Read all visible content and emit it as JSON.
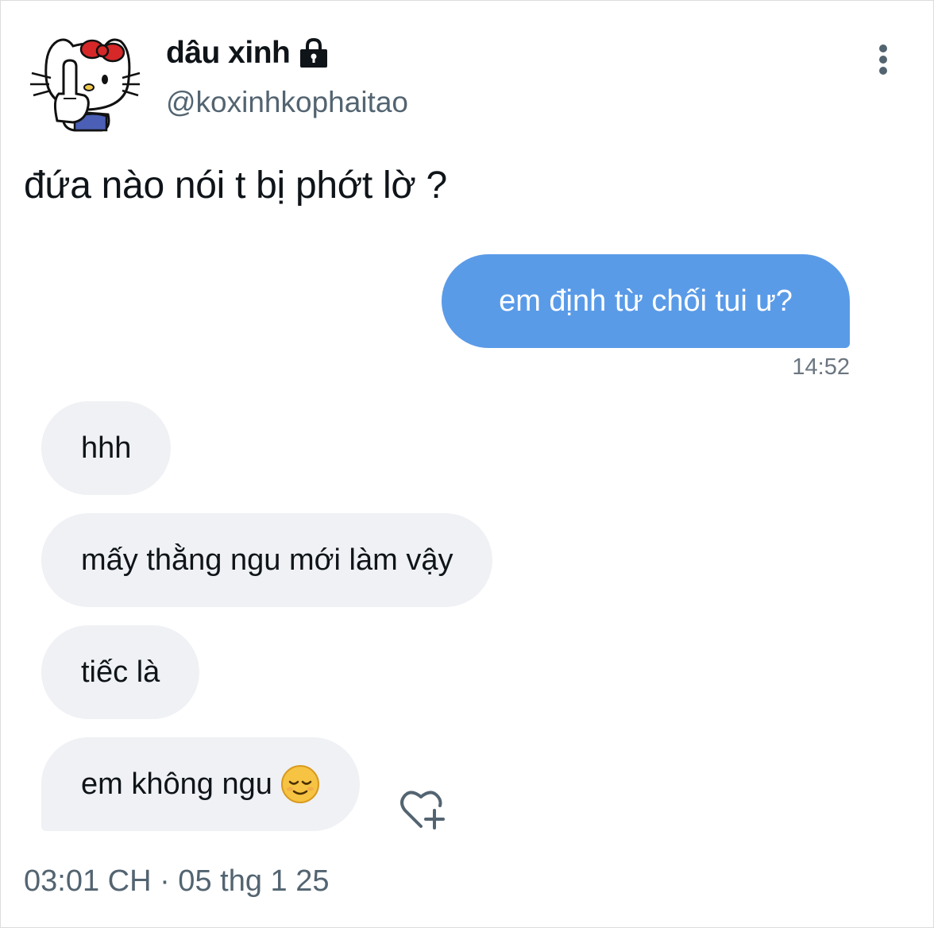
{
  "author": {
    "display_name": "dâu xinh",
    "handle": "@koxinhkophaitao",
    "avatar_icon": "hello-kitty-avatar-icon",
    "protected_icon": "lock-icon"
  },
  "menu": {
    "more_icon": "more-vertical-icon"
  },
  "tweet": {
    "text": "đứa nào nói t bị phớt lờ ?"
  },
  "chat": {
    "sent": {
      "text": "em định từ chối tui ư?",
      "time": "14:52"
    },
    "received": [
      {
        "text": "hhh"
      },
      {
        "text": "mấy thằng ngu mới làm vậy"
      },
      {
        "text": "tiếc là"
      },
      {
        "text": "em không ngu",
        "emoji": "relieved-face-emoji"
      }
    ],
    "react_icon": "add-reaction-heart-icon"
  },
  "meta": {
    "timestamp": "03:01 CH · 05 thg 1 25"
  },
  "colors": {
    "sent_bubble": "#5a9be8",
    "received_bubble": "#eff1f4",
    "secondary_text": "#536471"
  }
}
